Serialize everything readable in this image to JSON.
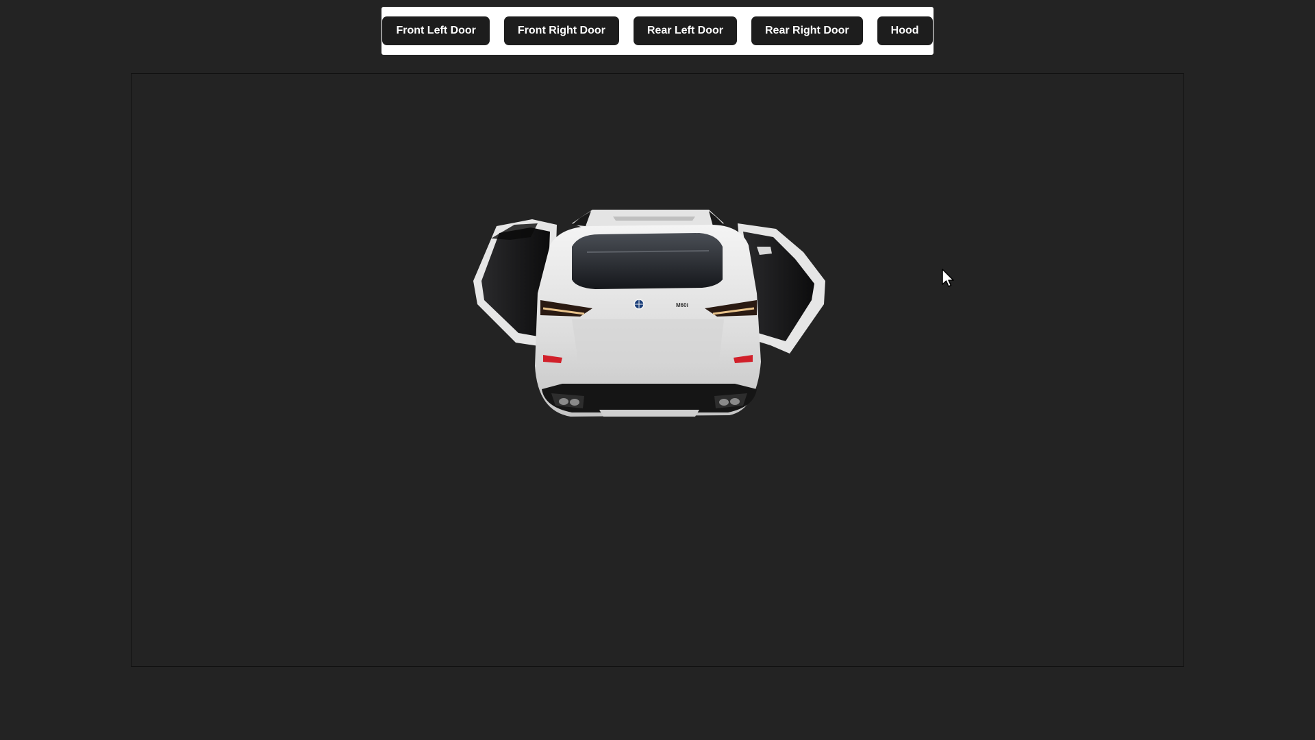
{
  "toolbar": {
    "buttons": [
      {
        "label": "Front Left Door"
      },
      {
        "label": "Front Right Door"
      },
      {
        "label": "Rear Left Door"
      },
      {
        "label": "Rear Right Door"
      },
      {
        "label": "Hood"
      }
    ]
  },
  "scene": {
    "model": "white-suv-rear-view-doors-open",
    "background_color": "#232323",
    "badge_text": "M60i"
  },
  "colors": {
    "toolbar_bg": "#ffffff",
    "button_bg": "#1d1d1d",
    "button_text": "#ffffff"
  }
}
